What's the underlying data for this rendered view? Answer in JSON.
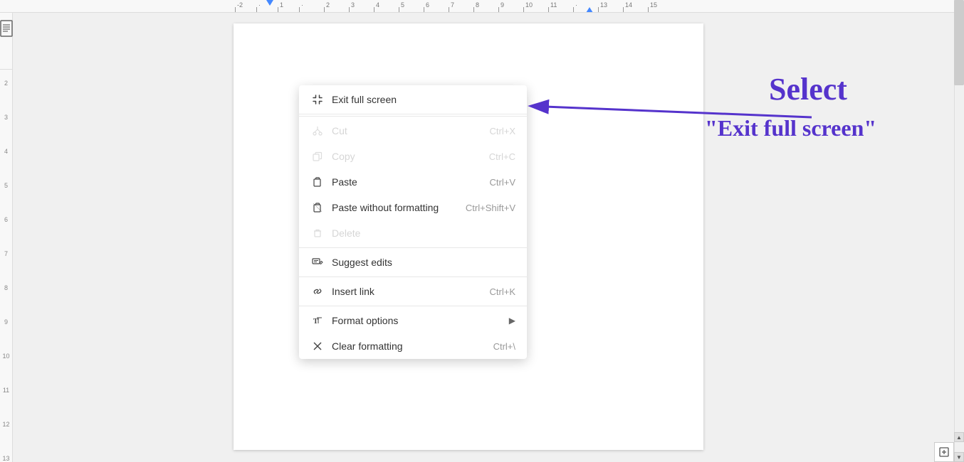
{
  "ruler": {
    "marks": [
      "-2",
      "1",
      "1",
      "2",
      "3",
      "4",
      "5",
      "6",
      "7",
      "8",
      "9",
      "10",
      "11",
      "13",
      "14",
      "15"
    ]
  },
  "context_menu": {
    "items": [
      {
        "id": "exit-full-screen",
        "label": "Exit full screen",
        "shortcut": "",
        "icon": "fullscreen-exit",
        "disabled": false,
        "divider_after": false,
        "has_arrow": false
      },
      {
        "id": "cut",
        "label": "Cut",
        "shortcut": "Ctrl+X",
        "icon": "cut",
        "disabled": true,
        "divider_after": false,
        "has_arrow": false
      },
      {
        "id": "copy",
        "label": "Copy",
        "shortcut": "Ctrl+C",
        "icon": "copy",
        "disabled": true,
        "divider_after": false,
        "has_arrow": false
      },
      {
        "id": "paste",
        "label": "Paste",
        "shortcut": "Ctrl+V",
        "icon": "paste",
        "disabled": false,
        "divider_after": false,
        "has_arrow": false
      },
      {
        "id": "paste-without-formatting",
        "label": "Paste without formatting",
        "shortcut": "Ctrl+Shift+V",
        "icon": "paste-plain",
        "disabled": false,
        "divider_after": false,
        "has_arrow": false
      },
      {
        "id": "delete",
        "label": "Delete",
        "shortcut": "",
        "icon": "delete",
        "disabled": true,
        "divider_after": true,
        "has_arrow": false
      },
      {
        "id": "suggest-edits",
        "label": "Suggest edits",
        "shortcut": "",
        "icon": "suggest",
        "disabled": false,
        "divider_after": true,
        "has_arrow": false
      },
      {
        "id": "insert-link",
        "label": "Insert link",
        "shortcut": "Ctrl+K",
        "icon": "link",
        "disabled": false,
        "divider_after": true,
        "has_arrow": false
      },
      {
        "id": "format-options",
        "label": "Format options",
        "shortcut": "",
        "icon": "format",
        "disabled": false,
        "divider_after": false,
        "has_arrow": true
      },
      {
        "id": "clear-formatting",
        "label": "Clear formatting",
        "shortcut": "Ctrl+\\",
        "icon": "clear-format",
        "disabled": false,
        "divider_after": false,
        "has_arrow": false
      }
    ]
  },
  "annotation": {
    "select_text": "Select",
    "exit_text": "\"Exit full screen\""
  },
  "arrow": {
    "color": "#5533cc"
  }
}
